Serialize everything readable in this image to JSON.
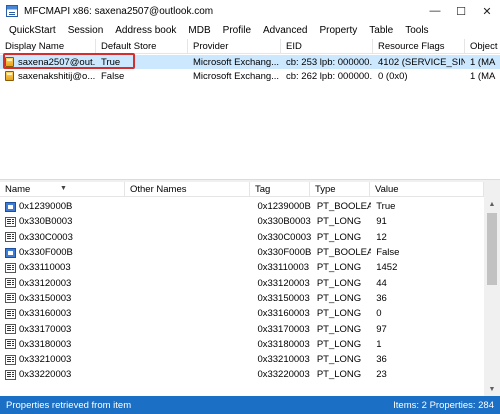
{
  "window": {
    "title": "MFCMAPI x86: saxena2507@outlook.com",
    "minimize": "—",
    "maximize": "☐",
    "close": "✕"
  },
  "menu": [
    "QuickStart",
    "Session",
    "Address book",
    "MDB",
    "Profile",
    "Advanced",
    "Property",
    "Table",
    "Tools"
  ],
  "stores": {
    "columns": [
      "Display Name",
      "Default Store",
      "Provider",
      "EID",
      "Resource Flags",
      "Object"
    ],
    "rows": [
      [
        "saxena2507@out...",
        "True",
        "Microsoft Exchang...",
        "cb: 253 lpb: 000000...",
        "4102 (SERVICE_SIN...",
        "1 (MA"
      ],
      [
        "saxenakshitij@o...",
        "False",
        "Microsoft Exchang...",
        "cb: 262 lpb: 000000...",
        "0 (0x0)",
        "1 (MA"
      ]
    ]
  },
  "properties": {
    "columns": [
      "Name",
      "Other Names",
      "Tag",
      "Type",
      "Value"
    ],
    "rows": [
      {
        "icon": "bool",
        "cells": [
          "0x1239000B",
          "",
          "0x1239000B",
          "PT_BOOLEAN",
          "True"
        ]
      },
      {
        "icon": "long",
        "cells": [
          "0x330B0003",
          "",
          "0x330B0003",
          "PT_LONG",
          "91"
        ]
      },
      {
        "icon": "long",
        "cells": [
          "0x330C0003",
          "",
          "0x330C0003",
          "PT_LONG",
          "12"
        ]
      },
      {
        "icon": "bool",
        "cells": [
          "0x330F000B",
          "",
          "0x330F000B",
          "PT_BOOLEAN",
          "False"
        ]
      },
      {
        "icon": "long",
        "cells": [
          "0x33110003",
          "",
          "0x33110003",
          "PT_LONG",
          "1452"
        ]
      },
      {
        "icon": "long",
        "cells": [
          "0x33120003",
          "",
          "0x33120003",
          "PT_LONG",
          "44"
        ]
      },
      {
        "icon": "long",
        "cells": [
          "0x33150003",
          "",
          "0x33150003",
          "PT_LONG",
          "36"
        ]
      },
      {
        "icon": "long",
        "cells": [
          "0x33160003",
          "",
          "0x33160003",
          "PT_LONG",
          "0"
        ]
      },
      {
        "icon": "long",
        "cells": [
          "0x33170003",
          "",
          "0x33170003",
          "PT_LONG",
          "97"
        ]
      },
      {
        "icon": "long",
        "cells": [
          "0x33180003",
          "",
          "0x33180003",
          "PT_LONG",
          "1"
        ]
      },
      {
        "icon": "long",
        "cells": [
          "0x33210003",
          "",
          "0x33210003",
          "PT_LONG",
          "36"
        ]
      },
      {
        "icon": "long",
        "cells": [
          "0x33220003",
          "",
          "0x33220003",
          "PT_LONG",
          "23"
        ]
      }
    ]
  },
  "status": {
    "left": "Properties retrieved from item",
    "right": "Items: 2  Properties: 284"
  },
  "colors": {
    "statusbar": "#1b6fc4",
    "selection": "#cce8ff",
    "highlight_box": "#d32f2f"
  }
}
